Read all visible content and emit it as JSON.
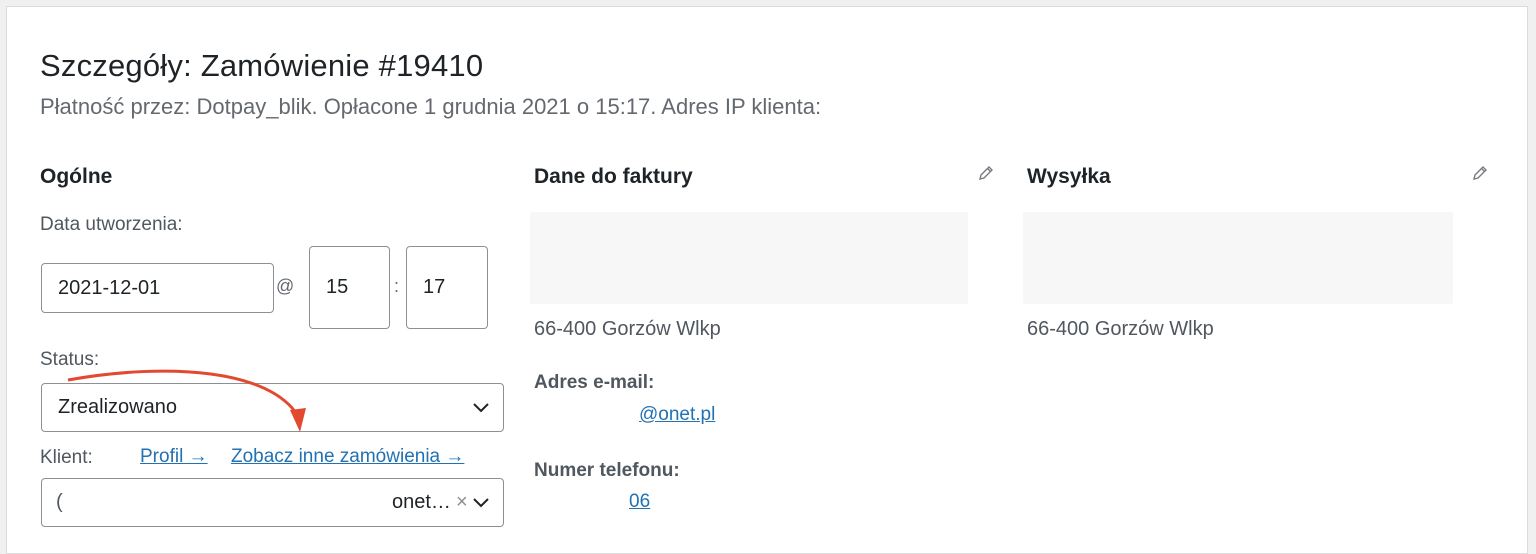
{
  "header": {
    "title": "Szczegóły: Zamówienie #19410",
    "subtitle": "Płatność przez: Dotpay_blik. Opłacone 1 grudnia 2021 o 15:17. Adres IP klienta:"
  },
  "general": {
    "title": "Ogólne",
    "date_label": "Data utworzenia:",
    "date_value": "2021-12-01",
    "at_sign": "@",
    "hour": "15",
    "colon": ":",
    "minute": "17",
    "status_label": "Status:",
    "status_value": "Zrealizowano",
    "client_label": "Klient:",
    "profile_link": "Profil →",
    "other_orders_link": "Zobacz inne zamówienia →",
    "client_value": "onet…",
    "client_prefix": "(",
    "clear_symbol": "×"
  },
  "billing": {
    "title": "Dane do faktury",
    "address_line": "66-400 Gorzów Wlkp",
    "email_label": "Adres e-mail:",
    "email_value": "@onet.pl",
    "phone_label": "Numer telefonu:",
    "phone_value": "06"
  },
  "shipping": {
    "title": "Wysyłka",
    "address_line": "66-400 Gorzów Wlkp"
  },
  "colors": {
    "link": "#2271b1",
    "annotation_arrow": "#e2492f",
    "text": "#1d2327",
    "muted": "#646970"
  },
  "icons": {
    "edit": "pencil-icon",
    "dropdown": "chevron-down-icon",
    "clear": "clear-x-icon"
  }
}
